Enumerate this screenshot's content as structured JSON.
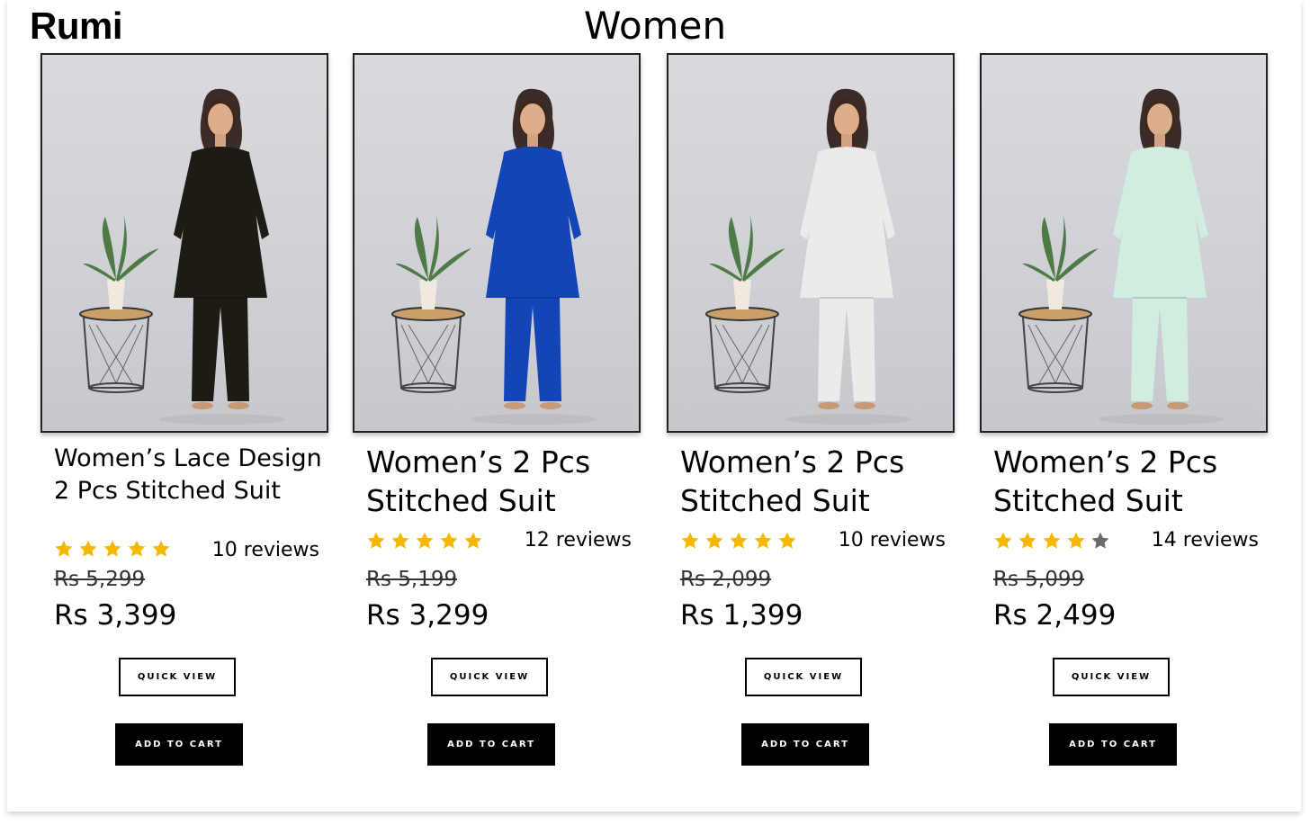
{
  "header": {
    "brand": "Rumi",
    "title": "Women"
  },
  "colors": {
    "star_filled": "#f5b800",
    "star_empty": "#6b6b6b",
    "button_dark": "#000000"
  },
  "products": [
    {
      "name": "Women’s Lace Design 2 Pcs Stitched Suit",
      "image_icon": "product-photo-black-printed-suit",
      "rating": 5,
      "rating_max": 5,
      "reviews": "10 reviews",
      "old_price": "Rs 5,299",
      "price": "Rs 3,399",
      "quick_view": "QUICK VIEW",
      "add_to_cart": "ADD TO CART",
      "outfit_color": "#1e1a14"
    },
    {
      "name": "Women’s 2 Pcs Stitched Suit",
      "image_icon": "product-photo-blue-suit",
      "rating": 5,
      "rating_max": 5,
      "reviews": "12 reviews",
      "old_price": "Rs 5,199",
      "price": "Rs 3,299",
      "quick_view": "QUICK VIEW",
      "add_to_cart": "ADD TO CART",
      "outfit_color": "#1344b8"
    },
    {
      "name": "Women’s 2 Pcs Stitched Suit",
      "image_icon": "product-photo-white-suit",
      "rating": 5,
      "rating_max": 5,
      "reviews": "10 reviews",
      "old_price": "Rs 2,099",
      "price": "Rs 1,399",
      "quick_view": "QUICK VIEW",
      "add_to_cart": "ADD TO CART",
      "outfit_color": "#ebebeb"
    },
    {
      "name": "Women’s 2 Pcs Stitched Suit",
      "image_icon": "product-photo-mint-floral-suit",
      "rating": 4,
      "rating_max": 5,
      "reviews": "14 reviews",
      "old_price": "Rs 5,099",
      "price": "Rs 2,499",
      "quick_view": "QUICK VIEW",
      "add_to_cart": "ADD TO CART",
      "outfit_color": "#cfeee0"
    }
  ]
}
